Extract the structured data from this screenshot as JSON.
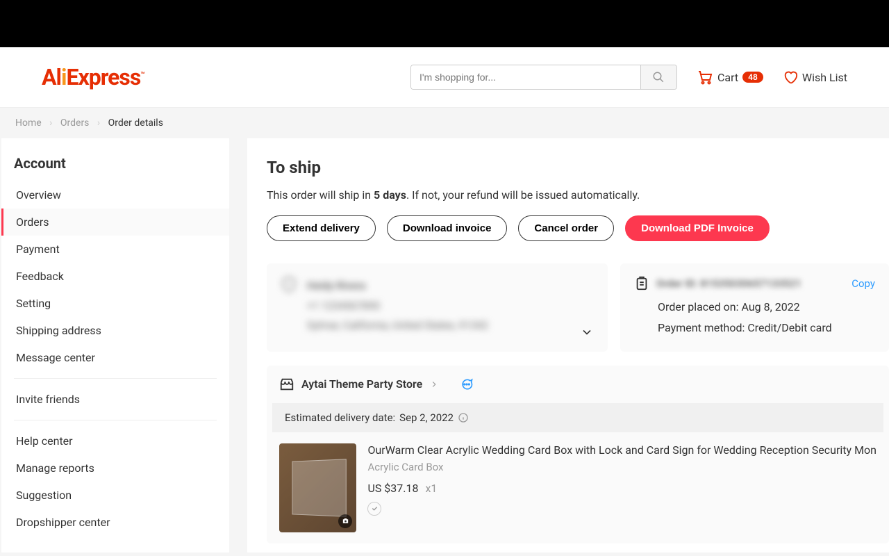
{
  "header": {
    "logo": "AliExpress",
    "search_placeholder": "I'm shopping for...",
    "cart_label": "Cart",
    "cart_count": "48",
    "wishlist_label": "Wish List"
  },
  "breadcrumb": {
    "home": "Home",
    "orders": "Orders",
    "current": "Order details"
  },
  "sidebar": {
    "title": "Account",
    "items": [
      {
        "label": "Overview"
      },
      {
        "label": "Orders"
      },
      {
        "label": "Payment"
      },
      {
        "label": "Feedback"
      },
      {
        "label": "Setting"
      },
      {
        "label": "Shipping address"
      },
      {
        "label": "Message center"
      }
    ],
    "group2": [
      {
        "label": "Invite friends"
      }
    ],
    "group3": [
      {
        "label": "Help center"
      },
      {
        "label": "Manage reports"
      },
      {
        "label": "Suggestion"
      },
      {
        "label": "Dropshipper center"
      }
    ]
  },
  "status": {
    "title": "To ship",
    "desc_before": "This order will ship in ",
    "desc_days": "5 days",
    "desc_after": ". If not, your refund will be issued automatically."
  },
  "actions": {
    "extend": "Extend delivery",
    "invoice": "Download invoice",
    "cancel": "Cancel order",
    "pdf": "Download PDF Invoice"
  },
  "shipping": {
    "name": "Heidy Rivera",
    "phone": "+1 1234567890",
    "address": "Sylmar, California, United States, 91342"
  },
  "order": {
    "id_label": "Order ID: 81535030657133521",
    "copy": "Copy",
    "placed": "Order placed on: Aug 8, 2022",
    "payment": "Payment method: Credit/Debit card"
  },
  "store": {
    "name": "Aytai Theme Party Store",
    "delivery_label": "Estimated delivery date: ",
    "delivery_date": "Sep 2, 2022"
  },
  "product": {
    "title": "OurWarm Clear Acrylic Wedding Card Box with Lock and Card Sign for Wedding Reception Security Mon",
    "variant": "Acrylic Card Box",
    "price": "US $37.18",
    "qty": "x1"
  }
}
